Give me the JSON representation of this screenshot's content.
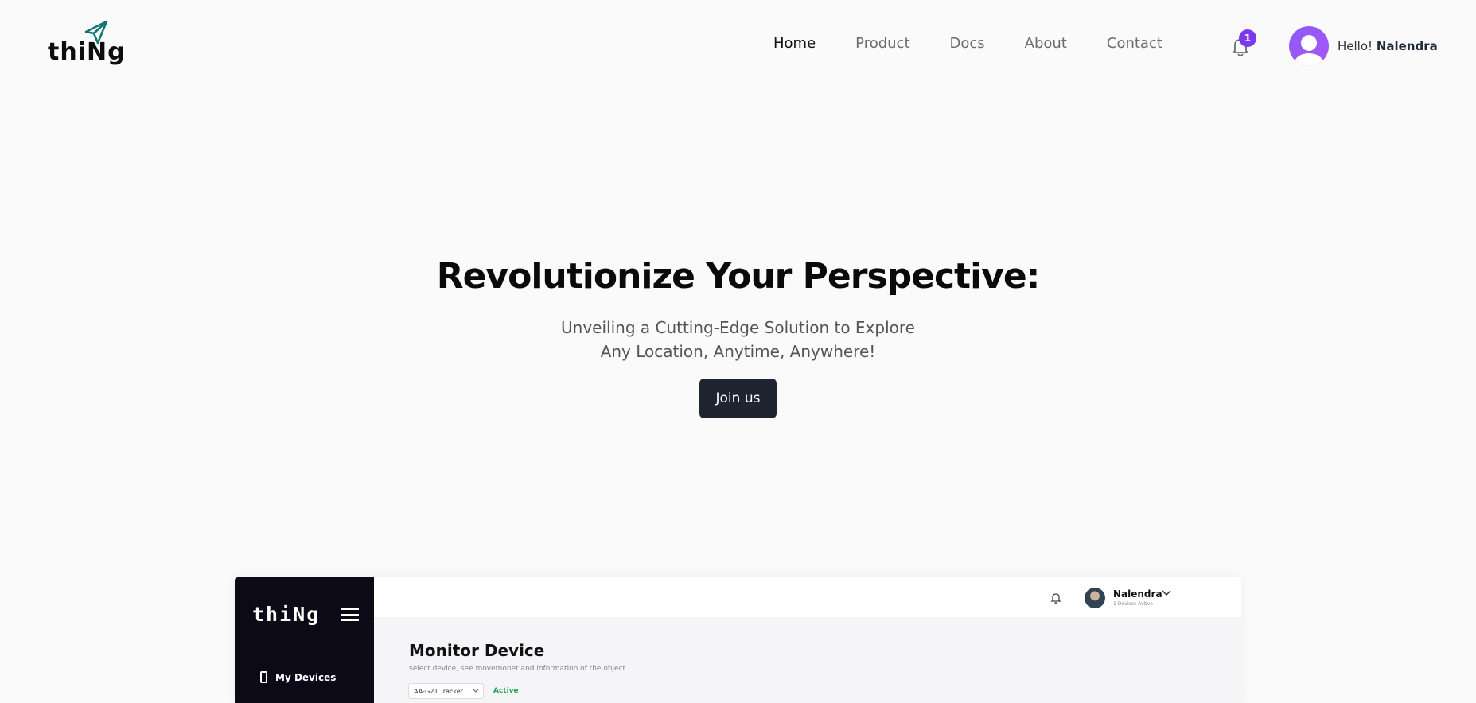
{
  "brand": {
    "logo_text": "thiNg"
  },
  "nav": {
    "items": [
      {
        "label": "Home",
        "active": true
      },
      {
        "label": "Product",
        "active": false
      },
      {
        "label": "Docs",
        "active": false
      },
      {
        "label": "About",
        "active": false
      },
      {
        "label": "Contact",
        "active": false
      }
    ]
  },
  "notifications": {
    "count": "1",
    "icon": "bell-icon",
    "badge_color": "#7c3aed"
  },
  "user": {
    "greeting_prefix": "Hello!",
    "name": "Nalendra"
  },
  "hero": {
    "title": "Revolutionize Your Perspective:",
    "subtitle_line1": "Unveiling a Cutting-Edge Solution to Explore",
    "subtitle_line2": "Any Location, Anytime, Anywhere!",
    "cta_label": "Join us"
  },
  "preview": {
    "logo_text": "thiNg",
    "sidebar_items": [
      {
        "label": "My Devices",
        "icon": "phone-icon"
      }
    ],
    "user_name": "Nalendra",
    "user_sub": "1 Devices Active",
    "page_title": "Monitor Device",
    "page_desc": "select device, see movemonet and information of the object",
    "device_select": "AA-G21 Tracker",
    "device_status": "Active"
  },
  "colors": {
    "cta_bg": "#1f2530",
    "sidebar_bg": "#0c0a16",
    "status_green": "#16a34a",
    "accent": "#7c3aed"
  }
}
